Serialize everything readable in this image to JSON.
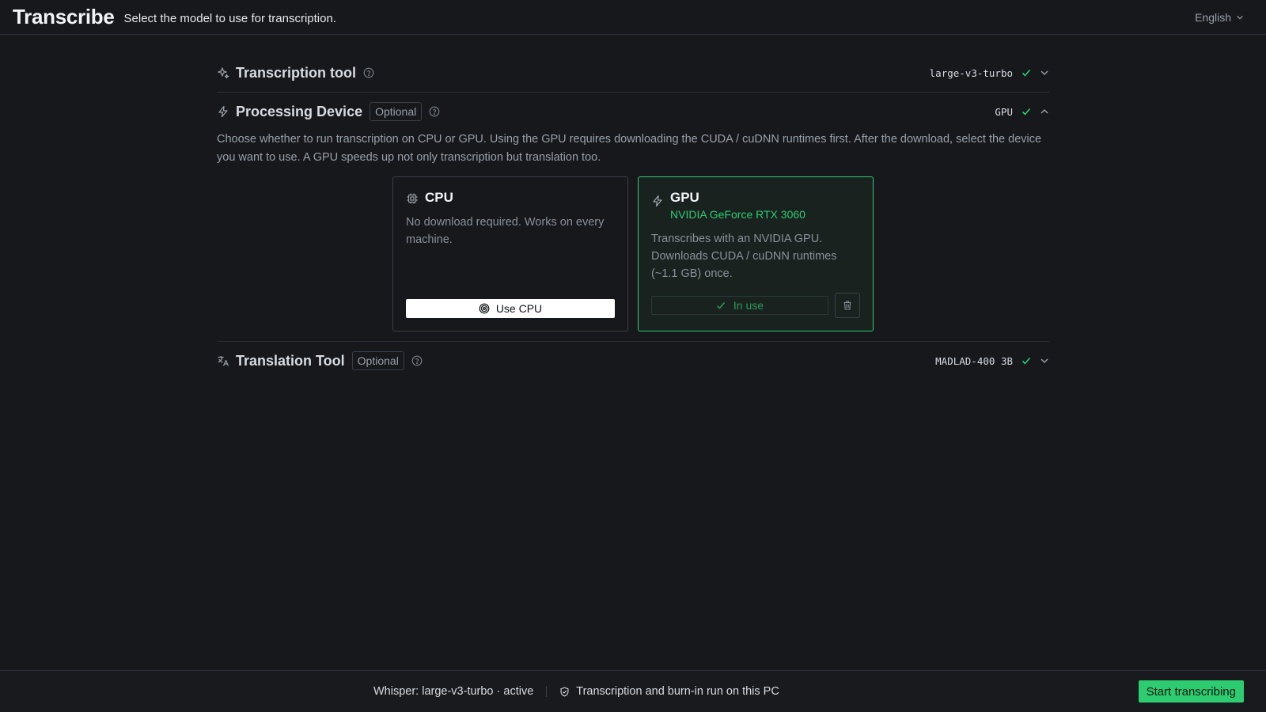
{
  "header": {
    "title": "Transcribe",
    "subtitle": "Select the model to use for transcription.",
    "language": "English"
  },
  "sections": {
    "transcription": {
      "title": "Transcription tool",
      "value": "large-v3-turbo",
      "icon": "sparkles-icon"
    },
    "processing": {
      "title": "Processing Device",
      "badge": "Optional",
      "value": "GPU",
      "icon": "zap-icon",
      "description": "Choose whether to run transcription on CPU or GPU. Using the GPU requires downloading the CUDA / cuDNN runtimes first. After the download, select the device you want to use. A GPU speeds up not only transcription but translation too.",
      "cards": {
        "cpu": {
          "title": "CPU",
          "description": "No download required. Works on every machine.",
          "button": "Use CPU"
        },
        "gpu": {
          "title": "GPU",
          "subtitle": "NVIDIA GeForce RTX 3060",
          "description": "Transcribes with an NVIDIA GPU. Downloads CUDA / cuDNN runtimes (~1.1 GB) once.",
          "button": "In use",
          "selected": true
        }
      }
    },
    "translation": {
      "title": "Translation Tool",
      "badge": "Optional",
      "value": "MADLAD-400 3B",
      "icon": "languages-icon"
    }
  },
  "footer": {
    "model_status": "Whisper: large-v3-turbo · active",
    "privacy": "Transcription and burn-in run on this PC",
    "start_button": "Start transcribing"
  },
  "colors": {
    "background": "#16181c",
    "accent": "#2ecc71",
    "border": "#2c3036",
    "muted_text": "#9aa0a8"
  }
}
